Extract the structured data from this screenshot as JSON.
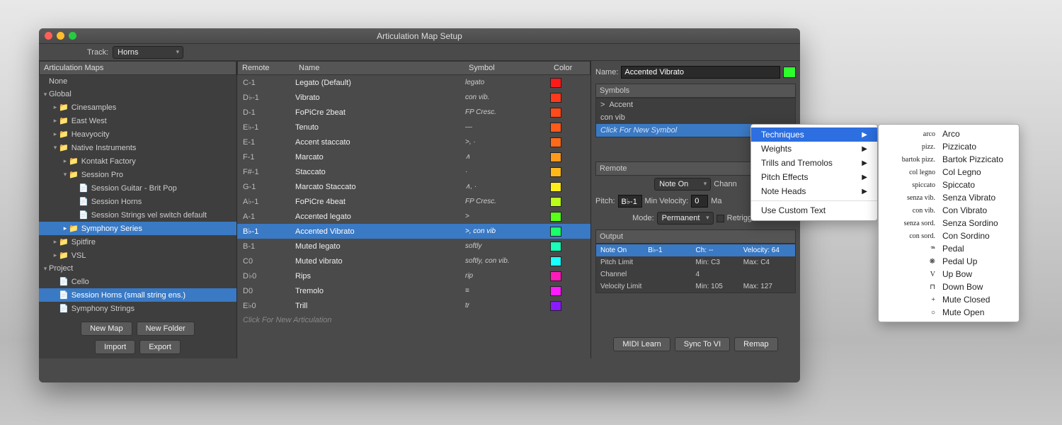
{
  "window": {
    "title": "Articulation Map Setup",
    "track_label": "Track:",
    "track_value": "Horns"
  },
  "left": {
    "header": "Articulation Maps",
    "tree": [
      {
        "t": "None",
        "d": 0,
        "i": 0
      },
      {
        "t": "Global",
        "d": 1,
        "i": 0,
        "open": 1
      },
      {
        "t": "Cinesamples",
        "d": 2,
        "i": 1,
        "f": 1
      },
      {
        "t": "East West",
        "d": 2,
        "i": 1,
        "f": 1
      },
      {
        "t": "Heavyocity",
        "d": 2,
        "i": 1,
        "f": 1
      },
      {
        "t": "Native Instruments",
        "d": 1,
        "i": 1,
        "f": 1,
        "open": 1
      },
      {
        "t": "Kontakt Factory",
        "d": 2,
        "i": 2,
        "f": 1
      },
      {
        "t": "Session Pro",
        "d": 1,
        "i": 2,
        "f": 1,
        "open": 1
      },
      {
        "t": "Session Guitar - Brit Pop",
        "d": 0,
        "i": 3,
        "doc": 1
      },
      {
        "t": "Session Horns",
        "d": 0,
        "i": 3,
        "doc": 1
      },
      {
        "t": "Session Strings vel switch default",
        "d": 0,
        "i": 3,
        "doc": 1
      },
      {
        "t": "Symphony Series",
        "d": 2,
        "i": 2,
        "f": 1,
        "sel": 1
      },
      {
        "t": "Spitfire",
        "d": 2,
        "i": 1,
        "f": 1
      },
      {
        "t": "VSL",
        "d": 2,
        "i": 1,
        "f": 1
      },
      {
        "t": "Project",
        "d": 1,
        "i": 0,
        "open": 1
      },
      {
        "t": "Cello",
        "d": 0,
        "i": 1,
        "doc": 1
      },
      {
        "t": "Session Horns (small string ens.)",
        "d": 0,
        "i": 1,
        "doc": 1,
        "sel": 1
      },
      {
        "t": "Symphony Strings",
        "d": 0,
        "i": 1,
        "doc": 1
      }
    ],
    "btns": [
      "New Map",
      "New Folder",
      "Import",
      "Export"
    ]
  },
  "mid": {
    "cols": {
      "remote": "Remote",
      "name": "Name",
      "symbol": "Symbol",
      "color": "Color"
    },
    "rows": [
      {
        "r": "C-1",
        "n": "Legato (Default)",
        "s": "legato",
        "c": "#ff1a1a"
      },
      {
        "r": "D♭-1",
        "n": "Vibrato",
        "s": "con vib.",
        "c": "#ff3a1a"
      },
      {
        "r": "D-1",
        "n": "FoPiCre 2beat",
        "s": "FP Cresc.",
        "c": "#ff4a1a"
      },
      {
        "r": "E♭-1",
        "n": "Tenuto",
        "s": "—",
        "c": "#ff5a1a"
      },
      {
        "r": "E-1",
        "n": "Accent staccato",
        "s": ">, ·",
        "c": "#ff6a1a"
      },
      {
        "r": "F-1",
        "n": "Marcato",
        "s": "∧",
        "c": "#ff9a1a"
      },
      {
        "r": "F#-1",
        "n": "Staccato",
        "s": "·",
        "c": "#ffba1a"
      },
      {
        "r": "G-1",
        "n": "Marcato Staccato",
        "s": "∧, ·",
        "c": "#ffee1a"
      },
      {
        "r": "A♭-1",
        "n": "FoPiCre 4beat",
        "s": "FP Cresc.",
        "c": "#baff1a"
      },
      {
        "r": "A-1",
        "n": "Accented legato",
        "s": ">",
        "c": "#5aff1a"
      },
      {
        "r": "B♭-1",
        "n": "Accented Vibrato",
        "s": ">, con vib",
        "c": "#1aff6a",
        "sel": 1
      },
      {
        "r": "B-1",
        "n": "Muted legato",
        "s": "softly",
        "c": "#1affba"
      },
      {
        "r": "C0",
        "n": "Muted vibrato",
        "s": "softly, con vib.",
        "c": "#1affff"
      },
      {
        "r": "D♭0",
        "n": "Rips",
        "s": "rip",
        "c": "#ff1aba"
      },
      {
        "r": "D0",
        "n": "Tremolo",
        "s": "≡",
        "c": "#ff1aff"
      },
      {
        "r": "E♭0",
        "n": "Trill",
        "s": "tr",
        "c": "#8a1aff"
      }
    ],
    "new": "Click For New Articulation"
  },
  "right": {
    "name_lbl": "Name:",
    "name_val": "Accented Vibrato",
    "symbols_hdr": "Symbols",
    "symbols": [
      {
        "s": ">",
        "t": "Accent"
      },
      {
        "s": "",
        "t": "con vib"
      }
    ],
    "new_symbol": "Click For New Symbol",
    "remote_hdr": "Remote",
    "note_on": "Note On",
    "chan_lbl": "Chann",
    "pitch_lbl": "Pitch:",
    "pitch_val": "B♭-1",
    "minvel_lbl": "Min Velocity:",
    "minvel_val": "0",
    "ma_lbl": "Ma",
    "mode_lbl": "Mode:",
    "mode_val": "Permanent",
    "retrigger": "Retrigger",
    "output_hdr": "Output",
    "output": [
      {
        "a": "Note On",
        "b": "B♭-1",
        "c": "Ch: --",
        "d": "Velocity: 64",
        "sel": 1
      },
      {
        "a": "Pitch Limit",
        "b": "",
        "c": "Min: C3",
        "d": "Max: C4"
      },
      {
        "a": "Channel",
        "b": "",
        "c": "4",
        "d": ""
      },
      {
        "a": "Velocity Limit",
        "b": "",
        "c": "Min: 105",
        "d": "Max: 127"
      }
    ],
    "btns": [
      "MIDI Learn",
      "Sync To VI",
      "Remap"
    ]
  },
  "ctx": {
    "items": [
      {
        "t": "Techniques",
        "sel": 1,
        "sub": 1
      },
      {
        "t": "Weights",
        "sub": 1
      },
      {
        "t": "Trills and Tremolos",
        "sub": 1
      },
      {
        "t": "Pitch Effects",
        "sub": 1
      },
      {
        "t": "Note Heads",
        "sub": 1
      }
    ],
    "sep": 1,
    "custom": "Use Custom Text"
  },
  "sub": {
    "items": [
      {
        "a": "arco",
        "t": "Arco"
      },
      {
        "a": "pizz.",
        "t": "Pizzicato"
      },
      {
        "a": "bartok pizz.",
        "t": "Bartok Pizzicato"
      },
      {
        "a": "col legno",
        "t": "Col Legno"
      },
      {
        "a": "spiccato",
        "t": "Spiccato"
      },
      {
        "a": "senza vib.",
        "t": "Senza Vibrato"
      },
      {
        "a": "con vib.",
        "t": "Con Vibrato"
      },
      {
        "a": "senza sord.",
        "t": "Senza Sordino"
      },
      {
        "a": "con sord.",
        "t": "Con Sordino"
      },
      {
        "a": "𝆮",
        "t": "Pedal"
      },
      {
        "a": "❋",
        "t": "Pedal Up"
      },
      {
        "a": "V",
        "t": "Up Bow"
      },
      {
        "a": "⊓",
        "t": "Down Bow"
      },
      {
        "a": "+",
        "t": "Mute Closed"
      },
      {
        "a": "○",
        "t": "Mute Open"
      }
    ]
  }
}
